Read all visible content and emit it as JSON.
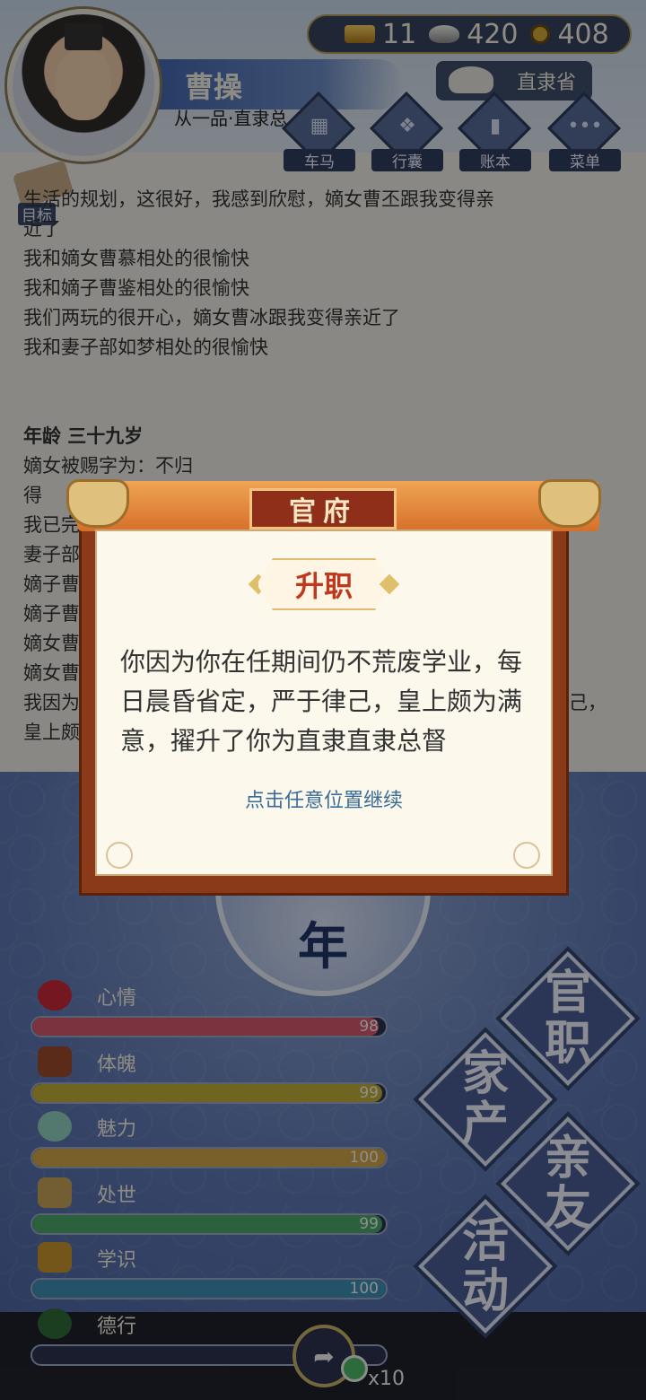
{
  "header": {
    "player_name": "曹操",
    "player_rank": "从一品·直隶总",
    "province": "直隶省",
    "currency": {
      "gold": "11",
      "silver": "420",
      "coins": "408"
    },
    "menu": [
      {
        "label": "车马",
        "icon": "carriage-icon"
      },
      {
        "label": "行囊",
        "icon": "bag-icon"
      },
      {
        "label": "账本",
        "icon": "ledger-icon"
      },
      {
        "label": "菜单",
        "icon": "more-icon"
      }
    ],
    "goal_label": "目标"
  },
  "log": {
    "lines": [
      "生活的规划，这很好，我感到欣慰，嫡女曹丕跟我变得亲",
      "近了",
      "我和嫡女曹慕相处的很愉快",
      "我和嫡子曹鉴相处的很愉快",
      "我们两玩的很开心，嫡女曹冰跟我变得亲近了",
      "我和妻子部如梦相处的很愉快"
    ],
    "age_heading": "年龄 三十九岁",
    "age_lines": [
      "嫡女被赐字为：不归",
      "得",
      "我已完",
      "妻子部",
      "嫡子曹",
      "嫡子曹",
      "嫡女曹",
      "嫡女曹",
      "我因为",
      "皇上颇"
    ],
    "age_line_tail": "己，"
  },
  "year_label": "年",
  "stats": [
    {
      "label": "心情",
      "value": "98",
      "percent": 98,
      "color": "#d4596f"
    },
    {
      "label": "体魄",
      "value": "99",
      "percent": 99,
      "color": "#bfae3a"
    },
    {
      "label": "魅力",
      "value": "100",
      "percent": 100,
      "color": "#d1a64a"
    },
    {
      "label": "处世",
      "value": "99",
      "percent": 99,
      "color": "#4aa86a"
    },
    {
      "label": "学识",
      "value": "100",
      "percent": 100,
      "color": "#3f8fb6"
    },
    {
      "label": "德行",
      "value": "",
      "percent": 0,
      "color": "#7a3aa3"
    }
  ],
  "actions": {
    "official": [
      "官",
      "职"
    ],
    "property": [
      "家",
      "产"
    ],
    "relatives": [
      "亲",
      "友"
    ],
    "activity": [
      "活",
      "动"
    ]
  },
  "bottom": {
    "reward_count": "x10"
  },
  "modal": {
    "header": "官府",
    "badge": "升职",
    "message": "你因为你在任期间仍不荒废学业，每日晨昏省定，严于律己，皇上颇为满意，擢升了你为直隶直隶总督",
    "hint": "点击任意位置继续"
  }
}
